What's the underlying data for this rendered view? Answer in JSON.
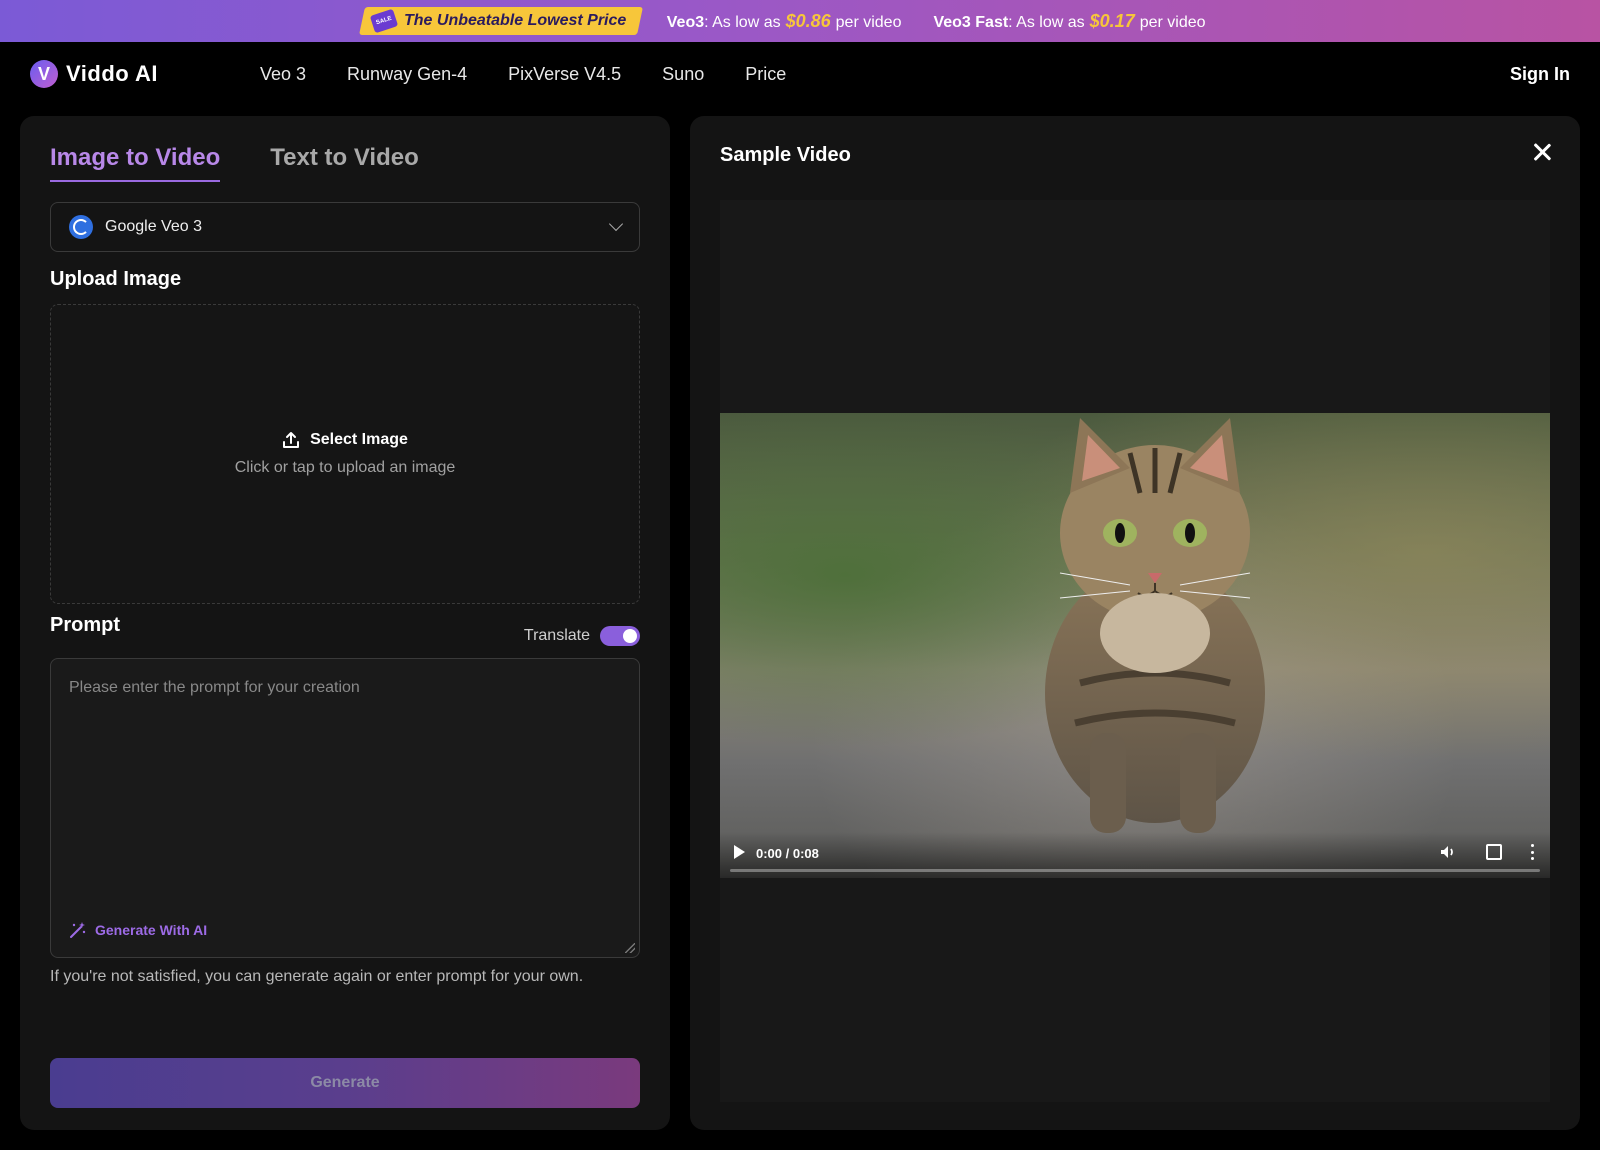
{
  "promo": {
    "sale_tag": "SALE",
    "headline": "The Unbeatable Lowest Price",
    "items": [
      {
        "name": "Veo3",
        "prefix": ": As low as",
        "price": "$0.86",
        "suffix": "per video"
      },
      {
        "name": "Veo3 Fast",
        "prefix": ": As low as",
        "price": "$0.17",
        "suffix": "per video"
      }
    ]
  },
  "nav": {
    "logo_text": "Viddo AI",
    "logo_letter": "V",
    "links": [
      "Veo 3",
      "Runway Gen-4",
      "PixVerse V4.5",
      "Suno",
      "Price"
    ],
    "sign_in": "Sign In"
  },
  "left": {
    "tabs": [
      {
        "label": "Image to Video",
        "active": true
      },
      {
        "label": "Text to Video",
        "active": false
      }
    ],
    "model": {
      "label": "Google Veo 3"
    },
    "upload": {
      "section_label": "Upload Image",
      "title": "Select Image",
      "subtitle": "Click or tap to upload an image"
    },
    "prompt": {
      "section_label": "Prompt",
      "translate_label": "Translate",
      "translate_on": true,
      "placeholder": "Please enter the prompt for your creation",
      "generate_ai_label": "Generate With AI",
      "hint": "If you're not satisfied, you can generate again or enter prompt for your own."
    },
    "generate_label": "Generate"
  },
  "right": {
    "title": "Sample Video",
    "video": {
      "time": "0:00 / 0:08",
      "progress": 0
    }
  },
  "colors": {
    "accent": "#9a6ae0",
    "price": "#f7c63a",
    "panel": "#141414"
  }
}
